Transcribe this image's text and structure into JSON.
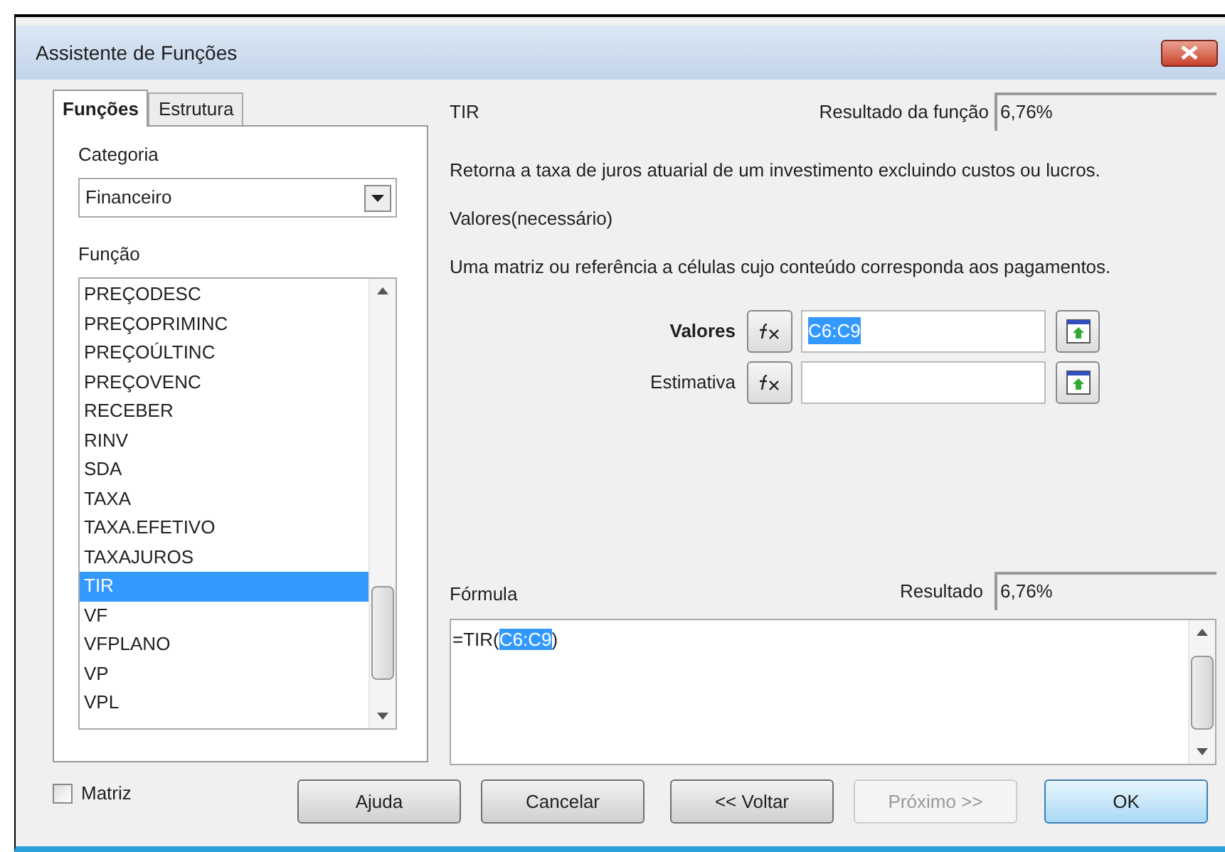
{
  "window": {
    "title": "Assistente de Funções"
  },
  "tabs": [
    {
      "label": "Funções",
      "selected": true
    },
    {
      "label": "Estrutura",
      "selected": false
    }
  ],
  "category": {
    "label": "Categoria",
    "value": "Financeiro"
  },
  "function_list": {
    "label": "Função",
    "items": [
      {
        "label": "PREÇODESC",
        "selected": false
      },
      {
        "label": "PREÇOPRIMINC",
        "selected": false
      },
      {
        "label": "PREÇOÚLTINC",
        "selected": false
      },
      {
        "label": "PREÇOVENC",
        "selected": false
      },
      {
        "label": "RECEBER",
        "selected": false
      },
      {
        "label": "RINV",
        "selected": false
      },
      {
        "label": "SDA",
        "selected": false
      },
      {
        "label": "TAXA",
        "selected": false
      },
      {
        "label": "TAXA.EFETIVO",
        "selected": false
      },
      {
        "label": "TAXAJUROS",
        "selected": false
      },
      {
        "label": "TIR",
        "selected": true
      },
      {
        "label": "VF",
        "selected": false
      },
      {
        "label": "VFPLANO",
        "selected": false
      },
      {
        "label": "VP",
        "selected": false
      },
      {
        "label": "VPL",
        "selected": false
      }
    ]
  },
  "function_name": "TIR",
  "function_result": {
    "label": "Resultado da função",
    "value": "6,76%"
  },
  "description": "Retorna a taxa de juros atuarial de um investimento excluindo custos ou lucros.",
  "argument_title": "Valores(necessário)",
  "argument_description": "Uma matriz ou referência a células cujo conteúdo corresponda aos pagamentos.",
  "arguments": [
    {
      "label": "Valores",
      "active": true,
      "value": "C6:C9"
    },
    {
      "label": "Estimativa",
      "active": false
    }
  ],
  "formula": {
    "label": "Fórmula",
    "parts": [
      {
        "text": "=TIR(",
        "selected": false
      },
      {
        "text": "C6:C9",
        "selected": true
      },
      {
        "text": ")",
        "selected": false
      }
    ]
  },
  "result": {
    "label": "Resultado",
    "value": "6,76%"
  },
  "matrix": {
    "label": "Matriz",
    "checked": false
  },
  "buttons": [
    {
      "label": "Ajuda",
      "disabled": false,
      "default": false
    },
    {
      "label": "Cancelar",
      "disabled": false,
      "default": false
    },
    {
      "label": "<< Voltar",
      "disabled": false,
      "default": false
    },
    {
      "label": "Próximo >>",
      "disabled": true,
      "default": false
    },
    {
      "label": "OK",
      "disabled": false,
      "default": true
    }
  ]
}
